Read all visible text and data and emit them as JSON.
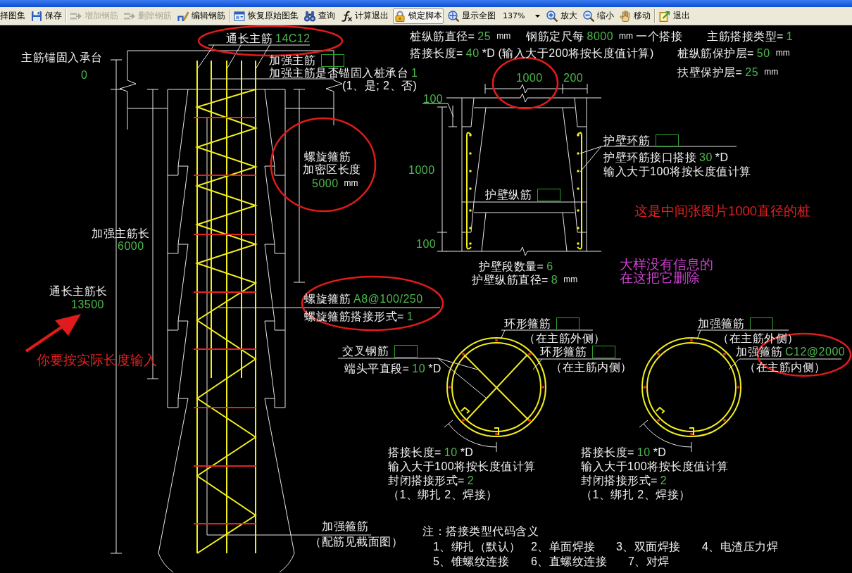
{
  "toolbar": {
    "groups": [
      {
        "items": [
          {
            "kind": "text",
            "label": "择图集",
            "disabled": false,
            "pressed": false
          },
          {
            "kind": "save",
            "label": "保存",
            "disabled": false,
            "pressed": false
          }
        ]
      },
      {
        "items": [
          {
            "kind": "add",
            "label": "增加钢筋",
            "disabled": true,
            "pressed": false
          },
          {
            "kind": "delete",
            "label": "删除钢筋",
            "disabled": true,
            "pressed": false
          },
          {
            "kind": "edit",
            "label": "编辑钢筋",
            "disabled": false,
            "pressed": false
          }
        ]
      },
      {
        "items": [
          {
            "kind": "restore",
            "label": "恢复原始图集",
            "disabled": false,
            "pressed": false
          },
          {
            "kind": "query",
            "label": "查询",
            "disabled": false,
            "pressed": false
          },
          {
            "kind": "formula",
            "label": "计算退出",
            "disabled": false,
            "pressed": false
          },
          {
            "kind": "lock",
            "label": "锁定脚本",
            "disabled": false,
            "pressed": true
          },
          {
            "kind": "fit",
            "label": "显示全图",
            "disabled": false,
            "pressed": false
          },
          {
            "kind": "zoom_select",
            "value": "137%",
            "disabled": false,
            "pressed": false
          },
          {
            "kind": "zoom_in",
            "label": "放大",
            "disabled": false,
            "pressed": false
          },
          {
            "kind": "zoom_out",
            "label": "缩小",
            "disabled": false,
            "pressed": false
          },
          {
            "kind": "move",
            "label": "移动",
            "disabled": false,
            "pressed": false
          }
        ]
      },
      {
        "items": [
          {
            "kind": "exit",
            "label": "退出",
            "disabled": false,
            "pressed": false
          }
        ]
      }
    ]
  },
  "pile_elevation": {
    "lines": [
      [
        {
          "kind": "label",
          "text": "通长主筋"
        },
        {
          "kind": "value",
          "text": "14C12"
        }
      ],
      [
        {
          "kind": "label",
          "text": "主筋锚固入承台"
        }
      ],
      [
        {
          "kind": "value",
          "text": "0"
        }
      ],
      [
        {
          "kind": "label",
          "text": "加强主筋"
        },
        {
          "kind": "field"
        }
      ],
      [
        {
          "kind": "label",
          "text": "加强主筋是否锚固入桩承台"
        },
        {
          "kind": "value",
          "text": "1"
        }
      ],
      [
        {
          "kind": "label",
          "text": "(1、是; 2、否)"
        }
      ],
      [
        {
          "kind": "label",
          "text": "螺旋箍筋"
        }
      ],
      [
        {
          "kind": "label",
          "text": "加密区长度"
        }
      ],
      [
        {
          "kind": "value",
          "text": "5000"
        },
        {
          "kind": "unit",
          "text": "mm"
        }
      ],
      [
        {
          "kind": "label",
          "text": "加强主筋长"
        }
      ],
      [
        {
          "kind": "value",
          "text": "6000"
        }
      ],
      [
        {
          "kind": "label",
          "text": "通长主筋长"
        }
      ],
      [
        {
          "kind": "value",
          "text": "13500"
        }
      ],
      [
        {
          "kind": "label",
          "text": "螺旋箍筋"
        },
        {
          "kind": "value",
          "text": "A8@100/250"
        }
      ],
      [
        {
          "kind": "label",
          "text": "螺旋箍筋搭接形式="
        },
        {
          "kind": "value",
          "text": "1"
        }
      ],
      [
        {
          "kind": "label",
          "text": "加强箍筋"
        }
      ],
      [
        {
          "kind": "label",
          "text": "（配筋见截面图）"
        }
      ]
    ]
  },
  "pile_parameters": {
    "lines": [
      [
        {
          "kind": "label",
          "text": "桩纵筋直径="
        },
        {
          "kind": "value",
          "text": "25"
        },
        {
          "kind": "unit",
          "text": "mm"
        }
      ],
      [
        {
          "kind": "label",
          "text": "钢筋定尺每"
        },
        {
          "kind": "value",
          "text": "8000"
        },
        {
          "kind": "unit",
          "text": "mm"
        },
        {
          "kind": "label",
          "text": "一个搭接"
        }
      ],
      [
        {
          "kind": "label",
          "text": "主筋搭接类型="
        },
        {
          "kind": "value",
          "text": "1"
        }
      ],
      [
        {
          "kind": "label",
          "text": "搭接长度="
        },
        {
          "kind": "value",
          "text": "40"
        },
        {
          "kind": "label",
          "text": "*D"
        },
        {
          "kind": "label",
          "text": "(输入大于200将按长度值计算)"
        }
      ],
      [
        {
          "kind": "label",
          "text": "桩纵筋保护层="
        },
        {
          "kind": "value",
          "text": "50"
        },
        {
          "kind": "unit",
          "text": "mm"
        }
      ],
      [
        {
          "kind": "label",
          "text": "扶壁保护层="
        },
        {
          "kind": "value",
          "text": "25"
        },
        {
          "kind": "unit",
          "text": "mm"
        }
      ]
    ]
  },
  "wall_detail": {
    "lines": [
      [
        {
          "kind": "dimension",
          "text": "1000"
        }
      ],
      [
        {
          "kind": "dimension",
          "text": "200"
        }
      ],
      [
        {
          "kind": "dimension",
          "text": "100"
        }
      ],
      [
        {
          "kind": "dimension",
          "text": "1000"
        }
      ],
      [
        {
          "kind": "dimension",
          "text": "100"
        }
      ],
      [
        {
          "kind": "label",
          "text": "护壁环筋"
        },
        {
          "kind": "field"
        }
      ],
      [
        {
          "kind": "label",
          "text": "护壁环筋接口搭接"
        },
        {
          "kind": "value",
          "text": "30"
        },
        {
          "kind": "label",
          "text": "*D"
        }
      ],
      [
        {
          "kind": "label",
          "text": "输入大于100将按长度值计算"
        }
      ],
      [
        {
          "kind": "label",
          "text": "护壁纵筋"
        },
        {
          "kind": "field"
        }
      ],
      [
        {
          "kind": "label",
          "text": "护壁段数量="
        },
        {
          "kind": "value",
          "text": "6"
        }
      ],
      [
        {
          "kind": "label",
          "text": "护壁纵筋直径="
        },
        {
          "kind": "value",
          "text": "8"
        },
        {
          "kind": "unit",
          "text": "mm"
        }
      ]
    ]
  },
  "cross_section_left": {
    "lines": [
      [
        {
          "kind": "label",
          "text": "环形箍筋"
        },
        {
          "kind": "field"
        }
      ],
      [
        {
          "kind": "label",
          "text": "（在主筋外侧）"
        }
      ],
      [
        {
          "kind": "label",
          "text": "交叉钢筋"
        },
        {
          "kind": "field"
        }
      ],
      [
        {
          "kind": "label",
          "text": "端头平直段="
        },
        {
          "kind": "value",
          "text": "10"
        },
        {
          "kind": "label",
          "text": "*D"
        }
      ],
      [
        {
          "kind": "label",
          "text": "环形箍筋"
        },
        {
          "kind": "field"
        }
      ],
      [
        {
          "kind": "label",
          "text": "（在主筋内侧）"
        }
      ],
      [
        {
          "kind": "label",
          "text": "搭接长度="
        },
        {
          "kind": "value",
          "text": "10"
        },
        {
          "kind": "label",
          "text": "*D"
        }
      ],
      [
        {
          "kind": "label",
          "text": "输入大于100将按长度值计算"
        }
      ],
      [
        {
          "kind": "label",
          "text": "封闭搭接形式="
        },
        {
          "kind": "value",
          "text": "2"
        }
      ],
      [
        {
          "kind": "label",
          "text": "（1、绑扎  2、焊接）"
        }
      ]
    ]
  },
  "cross_section_right": {
    "lines": [
      [
        {
          "kind": "label",
          "text": "加强箍筋"
        },
        {
          "kind": "field"
        }
      ],
      [
        {
          "kind": "label",
          "text": "（在主筋外侧）"
        }
      ],
      [
        {
          "kind": "label",
          "text": "加强箍筋"
        },
        {
          "kind": "value",
          "text": "C12@2000"
        }
      ],
      [
        {
          "kind": "label",
          "text": "（在主筋内侧）"
        }
      ],
      [
        {
          "kind": "label",
          "text": "搭接长度="
        },
        {
          "kind": "value",
          "text": "10"
        },
        {
          "kind": "label",
          "text": "*D"
        }
      ],
      [
        {
          "kind": "label",
          "text": "输入大于100将按长度值计算"
        }
      ],
      [
        {
          "kind": "label",
          "text": "封闭搭接形式="
        },
        {
          "kind": "value",
          "text": "2"
        }
      ],
      [
        {
          "kind": "label",
          "text": "（1、绑扎  2、焊接）"
        }
      ]
    ]
  },
  "notes": {
    "title": "注：搭接类型代码含义",
    "codes": [
      "1、绑扎（默认）",
      "2、单面焊接",
      "3、双面焊接",
      "4、电渣压力焊",
      "5、锥螺纹连接",
      "6、直螺纹连接",
      "7、对焊"
    ]
  },
  "remarks": [
    {
      "text": "你要按实际长度输入",
      "color": "#e02020"
    },
    {
      "text": "这是中间张图片1000直径的桩",
      "color": "#e02020"
    },
    {
      "text": "大样没有信息的",
      "color": "#cc3fcc"
    },
    {
      "text": "在这把它删除",
      "color": "#cc3fcc"
    }
  ]
}
